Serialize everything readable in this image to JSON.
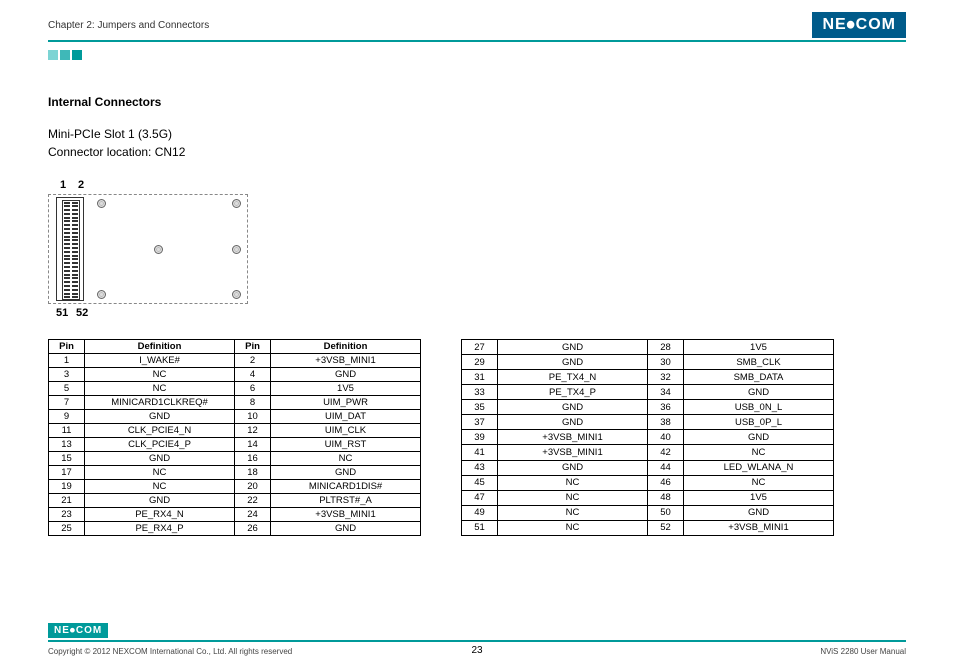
{
  "header": {
    "chapter": "Chapter 2: Jumpers and Connectors",
    "logo": "NE⦁COM"
  },
  "section": {
    "heading": "Internal Connectors",
    "sub1": "Mini-PCIe Slot 1 (3.5G)",
    "sub2": "Connector location: CN12"
  },
  "diagram_labels": {
    "p1": "1",
    "p2": "2",
    "p51": "51",
    "p52": "52"
  },
  "table_headers": {
    "pin": "Pin",
    "def": "Definition"
  },
  "pin_rows_left": [
    {
      "a": "1",
      "ad": "I_WAKE#",
      "b": "2",
      "bd": "+3VSB_MINI1"
    },
    {
      "a": "3",
      "ad": "NC",
      "b": "4",
      "bd": "GND"
    },
    {
      "a": "5",
      "ad": "NC",
      "b": "6",
      "bd": "1V5"
    },
    {
      "a": "7",
      "ad": "MINICARD1CLKREQ#",
      "b": "8",
      "bd": "UIM_PWR"
    },
    {
      "a": "9",
      "ad": "GND",
      "b": "10",
      "bd": "UIM_DAT"
    },
    {
      "a": "11",
      "ad": "CLK_PCIE4_N",
      "b": "12",
      "bd": "UIM_CLK"
    },
    {
      "a": "13",
      "ad": "CLK_PCIE4_P",
      "b": "14",
      "bd": "UIM_RST"
    },
    {
      "a": "15",
      "ad": "GND",
      "b": "16",
      "bd": "NC"
    },
    {
      "a": "17",
      "ad": "NC",
      "b": "18",
      "bd": "GND"
    },
    {
      "a": "19",
      "ad": "NC",
      "b": "20",
      "bd": "MINICARD1DIS#"
    },
    {
      "a": "21",
      "ad": "GND",
      "b": "22",
      "bd": "PLTRST#_A"
    },
    {
      "a": "23",
      "ad": "PE_RX4_N",
      "b": "24",
      "bd": "+3VSB_MINI1"
    },
    {
      "a": "25",
      "ad": "PE_RX4_P",
      "b": "26",
      "bd": "GND"
    }
  ],
  "pin_rows_right": [
    {
      "a": "27",
      "ad": "GND",
      "b": "28",
      "bd": "1V5"
    },
    {
      "a": "29",
      "ad": "GND",
      "b": "30",
      "bd": "SMB_CLK"
    },
    {
      "a": "31",
      "ad": "PE_TX4_N",
      "b": "32",
      "bd": "SMB_DATA"
    },
    {
      "a": "33",
      "ad": "PE_TX4_P",
      "b": "34",
      "bd": "GND"
    },
    {
      "a": "35",
      "ad": "GND",
      "b": "36",
      "bd": "USB_0N_L"
    },
    {
      "a": "37",
      "ad": "GND",
      "b": "38",
      "bd": "USB_0P_L"
    },
    {
      "a": "39",
      "ad": "+3VSB_MINI1",
      "b": "40",
      "bd": "GND"
    },
    {
      "a": "41",
      "ad": "+3VSB_MINI1",
      "b": "42",
      "bd": "NC"
    },
    {
      "a": "43",
      "ad": "GND",
      "b": "44",
      "bd": "LED_WLANA_N"
    },
    {
      "a": "45",
      "ad": "NC",
      "b": "46",
      "bd": "NC"
    },
    {
      "a": "47",
      "ad": "NC",
      "b": "48",
      "bd": "1V5"
    },
    {
      "a": "49",
      "ad": "NC",
      "b": "50",
      "bd": "GND"
    },
    {
      "a": "51",
      "ad": "NC",
      "b": "52",
      "bd": "+3VSB_MINI1"
    }
  ],
  "footer": {
    "logo": "NE⦁COM",
    "copyright": "Copyright © 2012 NEXCOM International Co., Ltd. All rights reserved",
    "page": "23",
    "manual": "NViS 2280 User Manual"
  }
}
